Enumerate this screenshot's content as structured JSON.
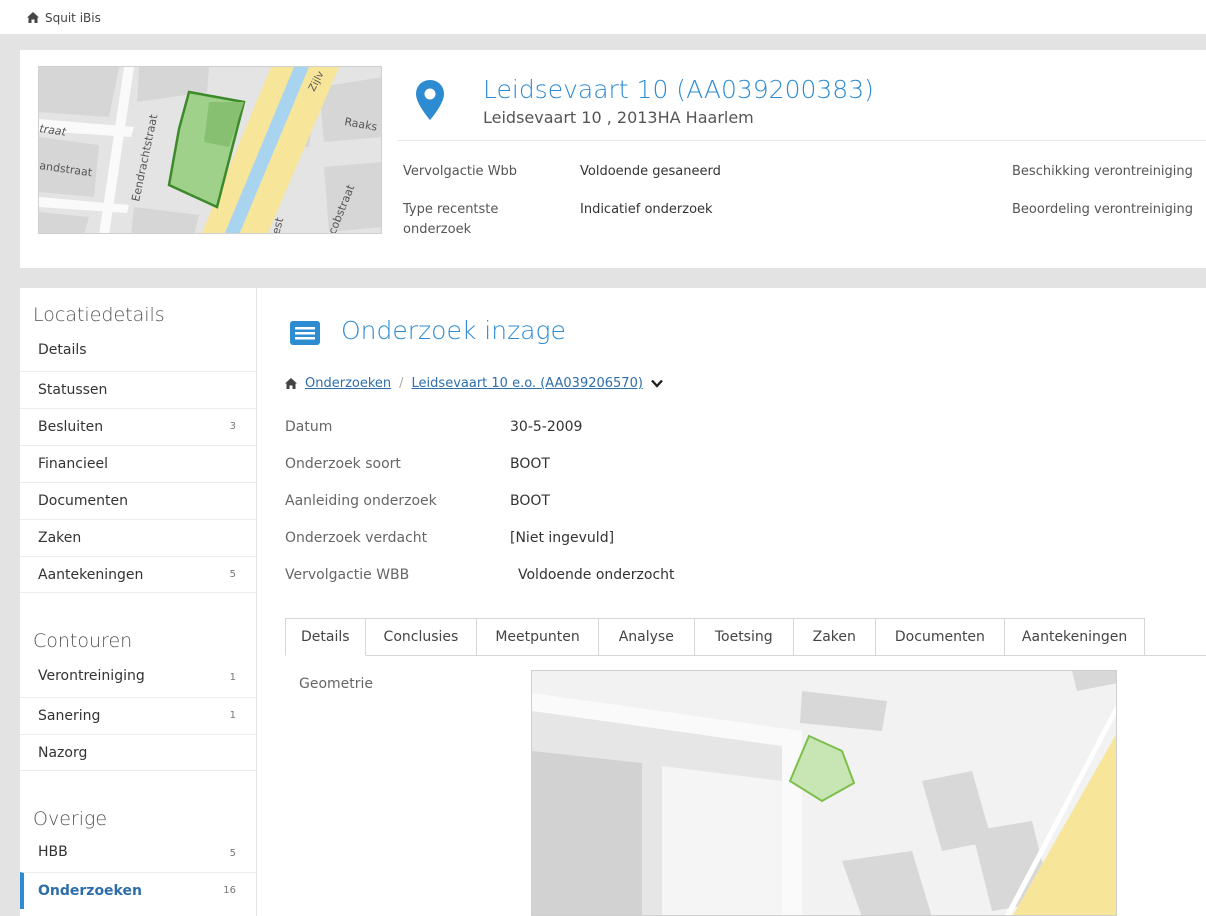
{
  "app": {
    "title": "Squit iBis"
  },
  "location": {
    "title": "Leidsevaart 10 (AA039200383)",
    "address": "Leidsevaart 10 , 2013HA Haarlem",
    "map_streets": [
      "traat",
      "Eendrachtstraat",
      "andstraat",
      "Raaks",
      "Zijlv",
      "cobstraat",
      "est"
    ],
    "fields": [
      {
        "label": "Vervolgactie Wbb",
        "value": "Voldoende gesaneerd"
      },
      {
        "label": "Type recentste onderzoek",
        "value": "Indicatief onderzoek"
      }
    ],
    "right_labels": [
      "Beschikking verontreiniging",
      "Beoordeling verontreiniging"
    ]
  },
  "sidebar": {
    "sections": [
      {
        "title": "Locatiedetails",
        "items": [
          {
            "label": "Details",
            "count": ""
          },
          {
            "label": "Statussen",
            "count": ""
          },
          {
            "label": "Besluiten",
            "count": "3"
          },
          {
            "label": "Financieel",
            "count": ""
          },
          {
            "label": "Documenten",
            "count": ""
          },
          {
            "label": "Zaken",
            "count": ""
          },
          {
            "label": "Aantekeningen",
            "count": "5"
          }
        ]
      },
      {
        "title": "Contouren",
        "items": [
          {
            "label": "Verontreiniging",
            "count": "1"
          },
          {
            "label": "Sanering",
            "count": "1"
          },
          {
            "label": "Nazorg",
            "count": ""
          }
        ]
      },
      {
        "title": "Overige",
        "items": [
          {
            "label": "HBB",
            "count": "5"
          },
          {
            "label": "Onderzoeken",
            "count": "16",
            "active": true
          }
        ]
      }
    ]
  },
  "main": {
    "title": "Onderzoek inzage",
    "breadcrumb": {
      "root": "Onderzoeken",
      "current": "Leidsevaart 10 e.o. (AA039206570)"
    },
    "fields": [
      {
        "label": "Datum",
        "value": "30-5-2009"
      },
      {
        "label": "Onderzoek soort",
        "value": "BOOT"
      },
      {
        "label": "Aanleiding onderzoek",
        "value": "BOOT"
      },
      {
        "label": "Onderzoek verdacht",
        "value": "[Niet ingevuld]"
      },
      {
        "label": "Vervolgactie WBB",
        "value": "Voldoende onderzocht"
      }
    ],
    "tabs": [
      "Details",
      "Conclusies",
      "Meetpunten",
      "Analyse",
      "Toetsing",
      "Zaken",
      "Documenten",
      "Aantekeningen"
    ],
    "active_tab": "Details",
    "geometry_label": "Geometrie"
  },
  "colors": {
    "accent": "#2d8bd2",
    "link": "#2d6eab",
    "parcel": "#9fd18a",
    "road": "#f7e59a",
    "water": "#a9d4ef"
  }
}
